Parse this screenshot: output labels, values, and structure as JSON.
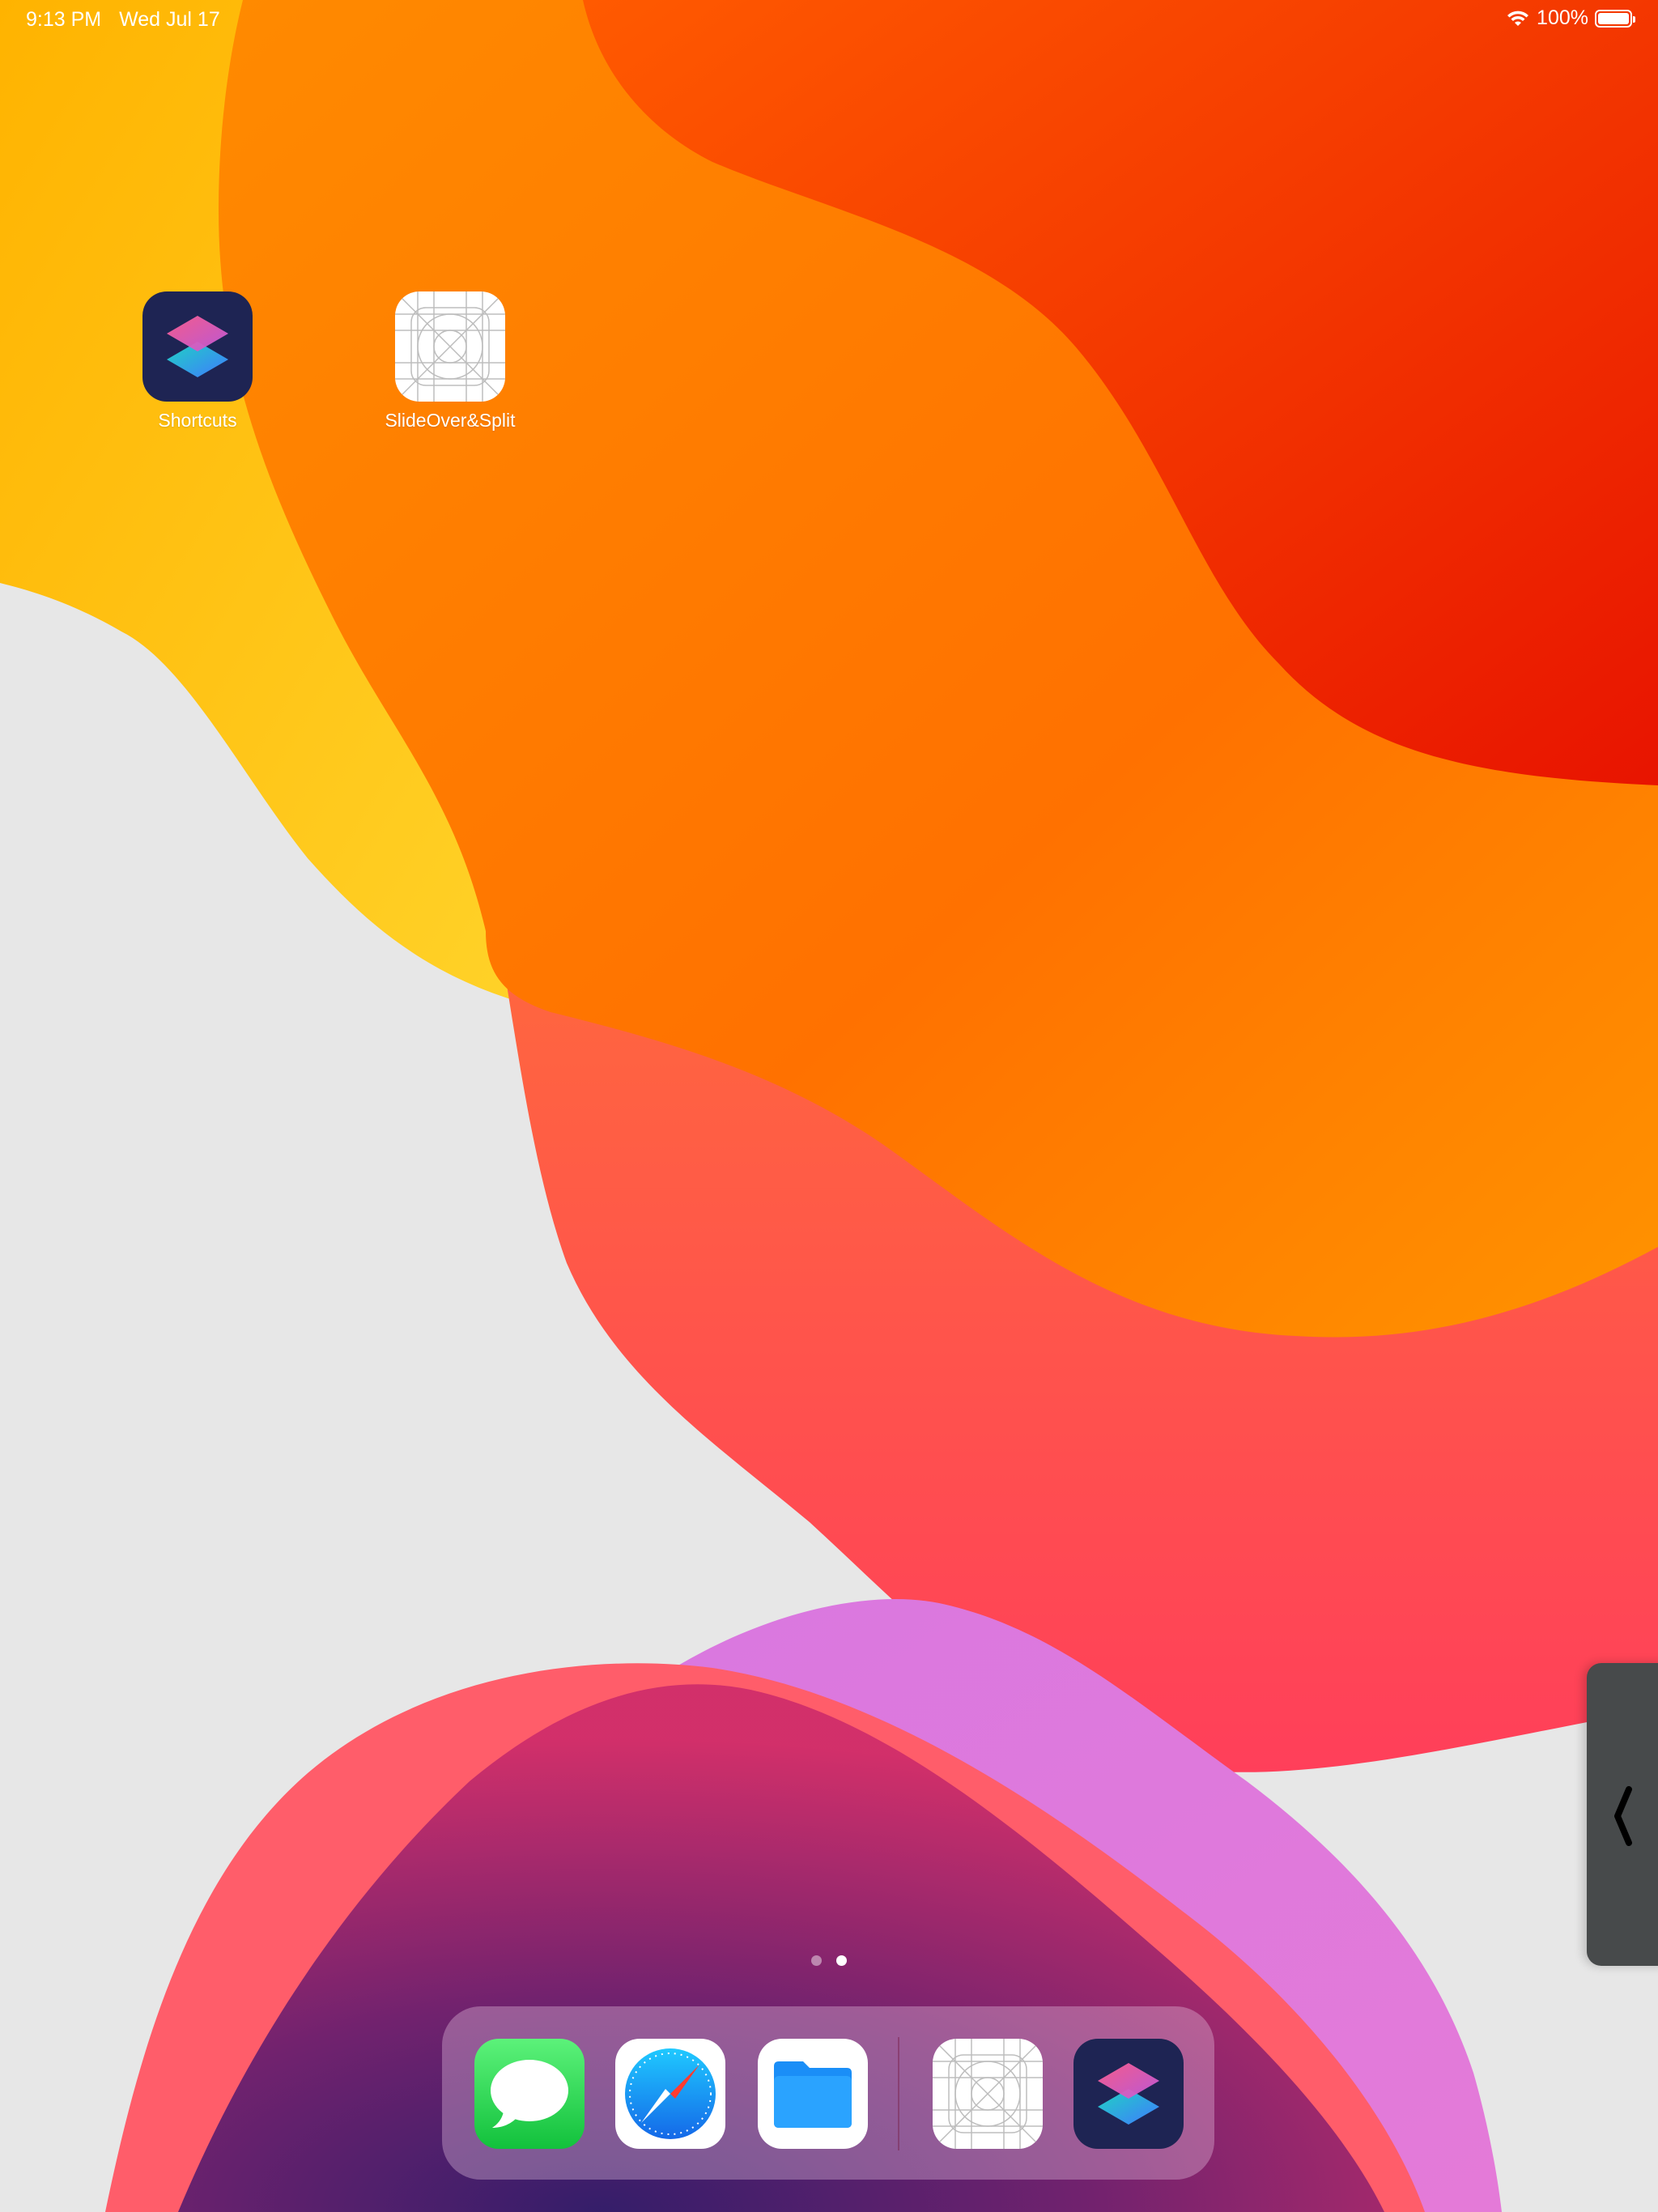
{
  "status_bar": {
    "time": "9:13 PM",
    "date": "Wed Jul 17",
    "battery_percent": "100%",
    "wifi_icon": "wifi-icon",
    "battery_icon": "battery-icon"
  },
  "home_apps": [
    {
      "label": "Shortcuts",
      "icon": "shortcuts-icon"
    },
    {
      "label": "SlideOver&Split",
      "icon": "app-placeholder-icon"
    }
  ],
  "page_indicator": {
    "pages": 2,
    "current": 2
  },
  "dock": {
    "apps": [
      {
        "name": "Messages",
        "icon": "messages-icon"
      },
      {
        "name": "Safari",
        "icon": "safari-icon"
      },
      {
        "name": "Files",
        "icon": "files-icon"
      },
      {
        "name": "SlideOver&Split",
        "icon": "app-placeholder-icon"
      },
      {
        "name": "Shortcuts",
        "icon": "shortcuts-icon"
      }
    ]
  },
  "slideover_handle": {
    "icon": "chevron-left-icon"
  },
  "colors": {
    "orange": "#ff7a00",
    "red": "#e8190a",
    "yellow": "#ffc400",
    "magenta": "#d66bd9",
    "pink": "#ff4a67",
    "background": "#e7e7e7"
  }
}
